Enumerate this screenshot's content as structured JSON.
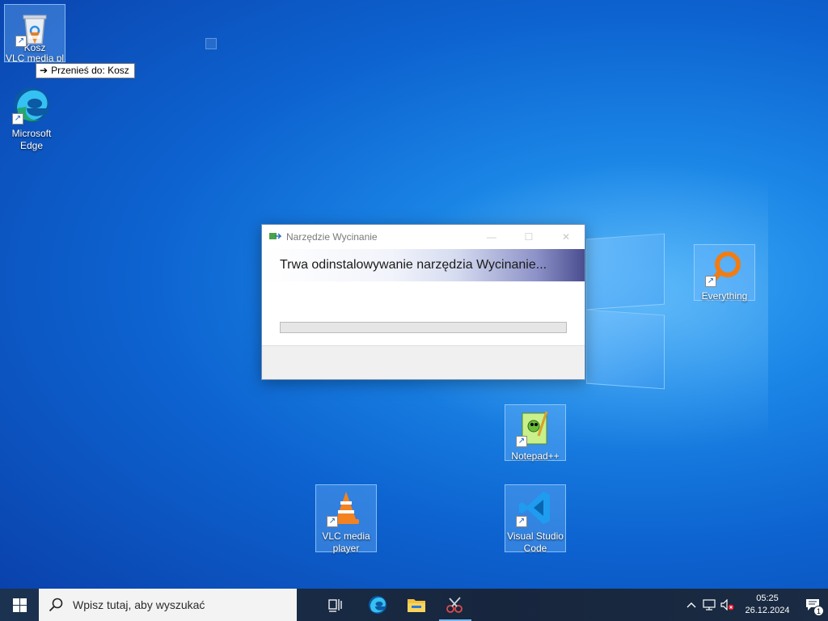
{
  "desktop": {
    "icons": [
      {
        "label": "Kosz"
      },
      {
        "label": "VLC media pla"
      },
      {
        "label": "Microsoft Edge"
      },
      {
        "label": "Everything"
      },
      {
        "label": "Notepad++"
      },
      {
        "label": "VLC media player"
      },
      {
        "label": "Visual Studio Code"
      }
    ],
    "drag_tooltip": "Przenieś do: Kosz"
  },
  "dialog": {
    "title": "Narzędzie Wycinanie",
    "heading": "Trwa odinstalowywanie narzędzia Wycinanie...",
    "progress": 0
  },
  "taskbar": {
    "search_placeholder": "Wpisz tutaj, aby wyszukać",
    "time": "05:25",
    "date": "26.12.2024",
    "notification_count": "1"
  },
  "colors": {
    "accent": "#0078d7",
    "desktop_bg": "#0d63d0",
    "progress_fill": "#06b025"
  }
}
